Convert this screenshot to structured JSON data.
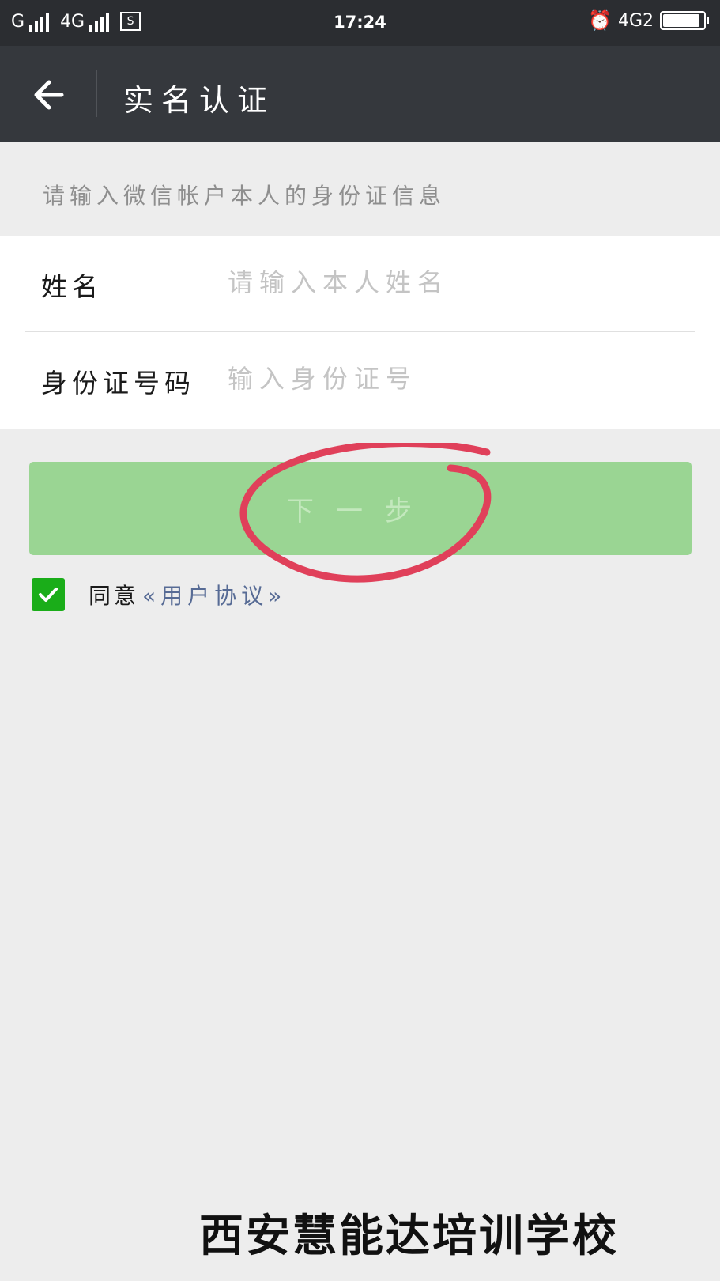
{
  "status_bar": {
    "carrier1": "G",
    "carrier2": "4G",
    "time": "17:24",
    "network_right": "4G2",
    "battery_level": 0.92
  },
  "nav": {
    "title": "实名认证",
    "back_icon": "arrow-left-icon"
  },
  "hint": "请输入微信帐户本人的身份证信息",
  "form": {
    "name_label": "姓名",
    "name_placeholder": "请输入本人姓名",
    "id_label": "身份证号码",
    "id_placeholder": "输入身份证号"
  },
  "next_button": "下一步",
  "agreement": {
    "text": "同意",
    "link": "«用户协议»",
    "checked": true
  },
  "watermark": "西安慧能达培训学校",
  "colors": {
    "primary_green": "#1aad19",
    "button_disabled": "#9ad593",
    "link_blue": "#576b95",
    "annotation_red": "#e0405a"
  }
}
